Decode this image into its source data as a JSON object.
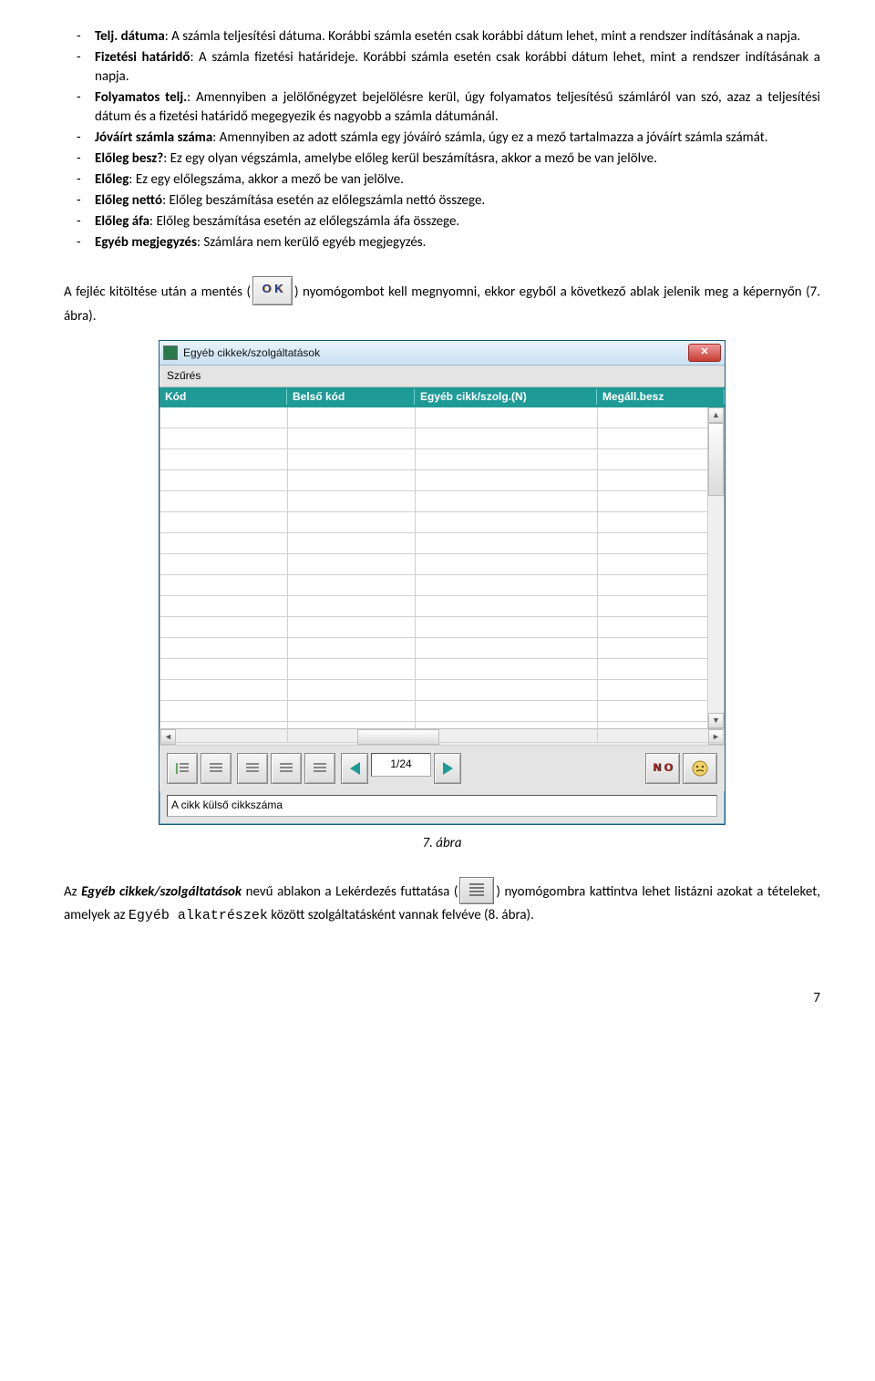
{
  "bullets": [
    {
      "term": "Telj. dátuma",
      "text": ": A számla teljesítési dátuma. Korábbi számla esetén csak korábbi dátum lehet, mint a rendszer indításának a napja."
    },
    {
      "term": "Fizetési határidő",
      "text": ": A számla fizetési határideje. Korábbi számla esetén csak korábbi dátum lehet, mint a rendszer indításának a napja."
    },
    {
      "term": "Folyamatos telj.",
      "text": ": Amennyiben a jelölőnégyzet bejelölésre kerül, úgy folyamatos teljesítésű számláról van szó, azaz a teljesítési dátum és a fizetési határidő megegyezik és nagyobb a számla dátumánál."
    },
    {
      "term": "Jóváírt számla száma",
      "text": ": Amennyiben az adott számla egy jóváíró számla, úgy ez a mező tartalmazza a jóváírt számla számát."
    },
    {
      "term": "Előleg besz?",
      "text": ": Ez egy olyan végszámla, amelybe előleg kerül beszámításra, akkor a mező be van jelölve."
    },
    {
      "term": "Előleg",
      "text": ": Ez egy előlegszáma, akkor a mező be van jelölve."
    },
    {
      "term": "Előleg nettó",
      "text": ": Előleg beszámítása esetén az előlegszámla nettó összege."
    },
    {
      "term": "Előleg áfa",
      "text": ": Előleg beszámítása esetén az előlegszámla áfa összege."
    },
    {
      "term": "Egyéb megjegyzés",
      "text": ": Számlára nem kerülő egyéb megjegyzés."
    }
  ],
  "para1": {
    "pre": "A fejléc kitöltése után a ",
    "mentes": "mentés",
    "open": " (",
    "ok": "O K",
    "close": ") nyomógombot kell megnyomni, ekkor egyből a következő ablak jelenik meg a képernyőn (7. ábra)."
  },
  "win": {
    "title": "Egyéb cikkek/szolgáltatások",
    "menu": "Szűrés",
    "cols": {
      "c1": "Kód",
      "c2": "Belső kód",
      "c3": "Egyéb cikk/szolg.(N)",
      "c4": "Megáll.besz"
    },
    "nav_text": "1/24",
    "no_label": "N O",
    "status": "A cikk külső cikkszáma"
  },
  "caption7": "7. ábra",
  "para2": {
    "pre": "Az ",
    "win_name": "Egyéb cikkek/szolgáltatások",
    "mid1": " nevű ablakon a ",
    "query": "Lekérdezés futtatása",
    "open": " (",
    "close": ") nyomógombra kattintva lehet listázni azokat a tételeket, amelyek az ",
    "mono": "Egyéb alkatrészek",
    "tail": " között szolgáltatásként vannak felvéve (8. ábra)."
  },
  "page_number": "7"
}
